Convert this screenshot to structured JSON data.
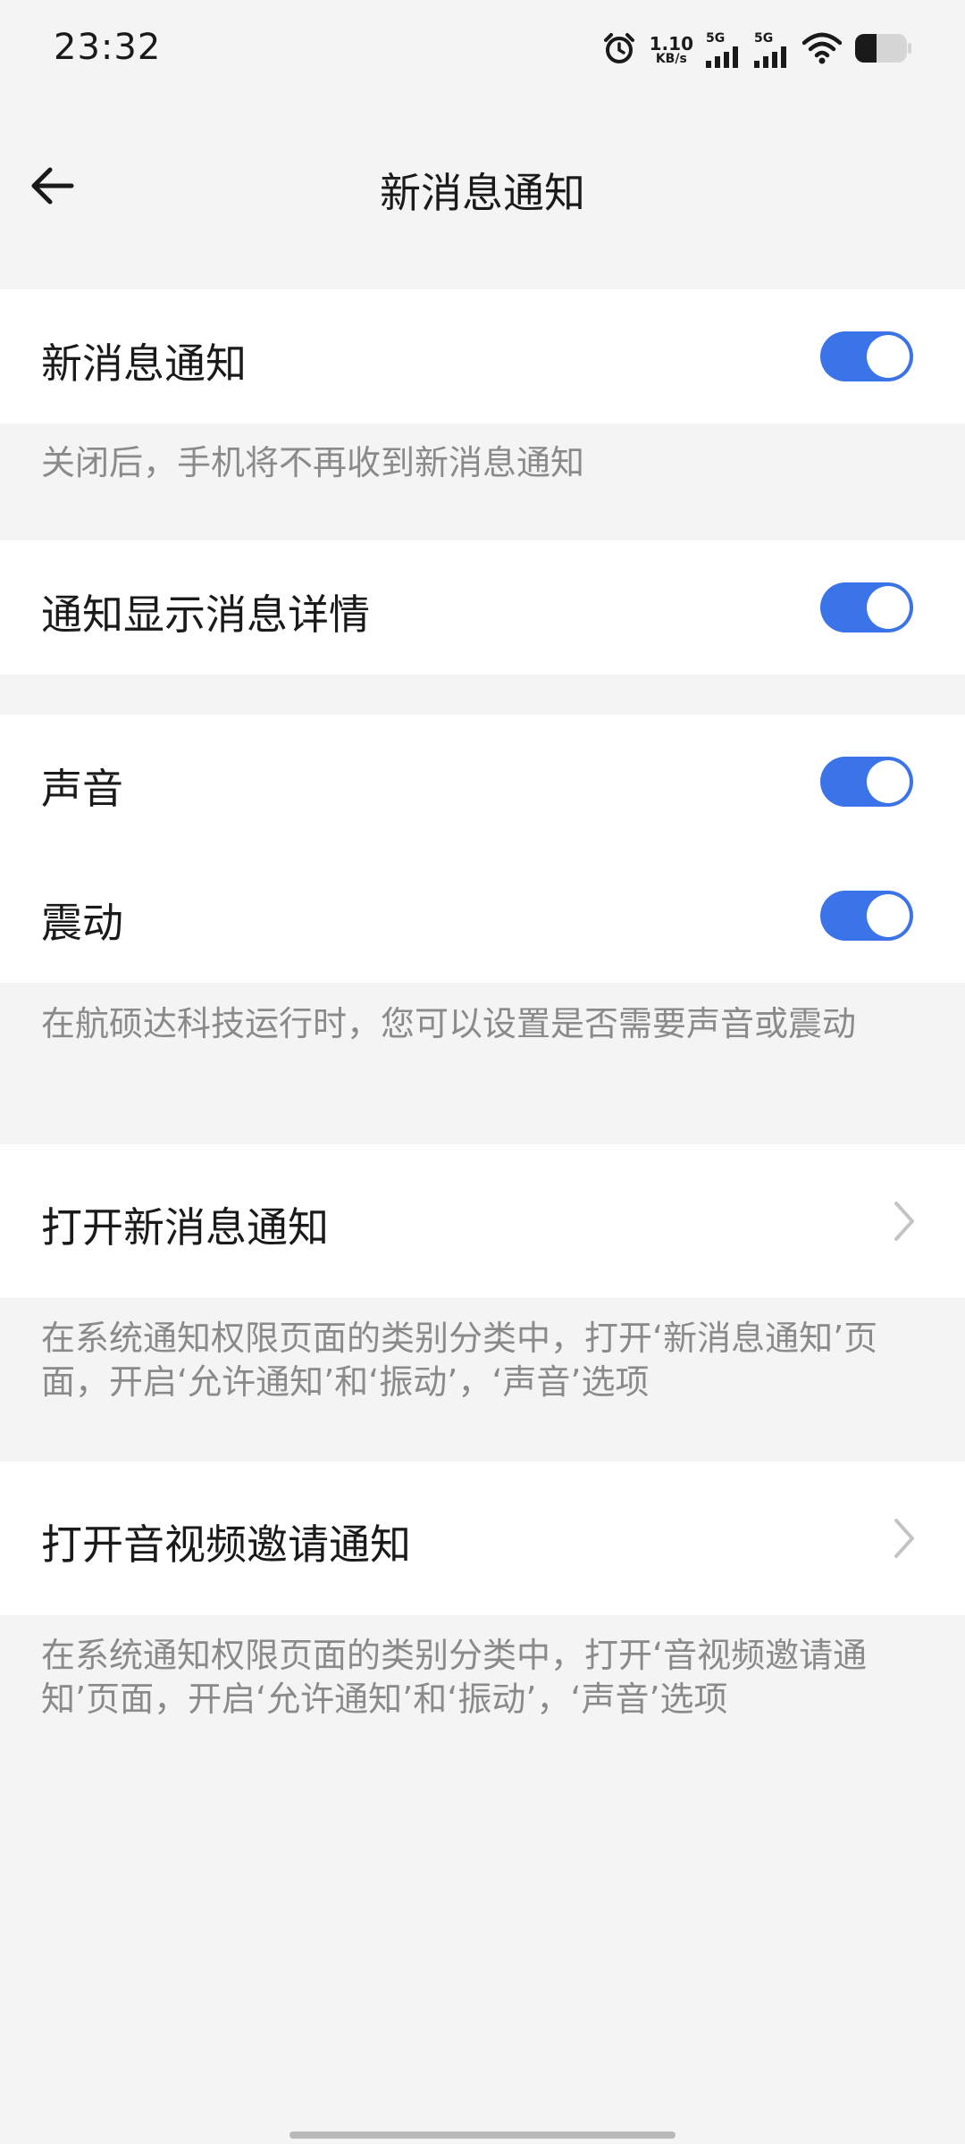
{
  "status_bar": {
    "time": "23:32",
    "net_speed_value": "1.10",
    "net_speed_unit": "KB/s",
    "sim1_label": "5G",
    "sim2_label": "5G",
    "icons": [
      "alarm-icon",
      "signal-icon",
      "signal-icon",
      "wifi-icon",
      "battery-icon"
    ]
  },
  "header": {
    "title": "新消息通知",
    "back_icon": "arrow-left-icon"
  },
  "settings": {
    "new_message_notification": {
      "label": "新消息通知",
      "enabled": true
    },
    "new_message_notification_desc": "关闭后，手机将不再收到新消息通知",
    "show_message_details": {
      "label": "通知显示消息详情",
      "enabled": true
    },
    "sound": {
      "label": "声音",
      "enabled": true
    },
    "vibration": {
      "label": "震动",
      "enabled": true
    },
    "sound_vibration_desc": "在航硕达科技运行时，您可以设置是否需要声音或震动",
    "open_new_message_notification": {
      "label": "打开新消息通知"
    },
    "open_new_message_notification_desc": "在系统通知权限页面的类别分类中，打开‘新消息通知’页面，开启‘允许通知’和‘振动’，‘声音’选项",
    "open_av_invite_notification": {
      "label": "打开音视频邀请通知"
    },
    "open_av_invite_notification_desc": "在系统通知权限页面的类别分类中，打开‘音视频邀请通知’页面，开启‘允许通知’和‘振动’，‘声音’选项"
  },
  "colors": {
    "accent": "#3b73e8",
    "background": "#f4f4f4",
    "card": "#ffffff",
    "secondary_text": "#8a8a8a"
  }
}
